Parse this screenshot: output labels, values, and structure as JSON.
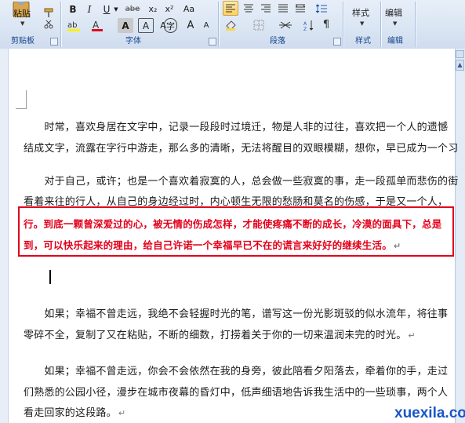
{
  "ribbon": {
    "groups": {
      "clipboard": "剪贴板",
      "font": "字体",
      "paragraph": "段落",
      "styles": "样式",
      "editing": "编辑"
    },
    "paste_label": "粘贴",
    "styles_label": "样式",
    "editing_label": "编辑",
    "font_buttons": [
      "B",
      "I",
      "U",
      "abe",
      "x₂",
      "x²",
      "Aa"
    ],
    "font_row2": [
      "A",
      "A",
      "A",
      "字",
      "A",
      "A"
    ]
  },
  "document": {
    "lines": [
      {
        "text": "　　时常，喜欢身居在文字中，记录一段段时过境迁，物是人非的过往，喜欢把一个人的遗憾",
        "style": "normal"
      },
      {
        "text": "结成文字，流露在字行中游走，那么多的清晰，无法将醒目的双眼模糊，想你，早已成为一个习",
        "style": "normal"
      },
      {
        "text": "　　对于自己，或许；也是一个喜欢着寂寞的人，总会做一些寂寞的事，走一段孤单而悲伤的街",
        "style": "normal"
      },
      {
        "text": "看着来往的行人，从自己的身边经过时，内心顿生无限的愁肠和莫名的伤感，于是又一个人，",
        "style": "normal"
      },
      {
        "text": "行。到底一颗曾深爱过的心，被无情的伤成怎样，才能使疼痛不断的成长，冷漠的面具下，总是",
        "style": "red"
      },
      {
        "text": "到，可以快乐起来的理由，给自己许诺一个幸福早已不在的谎言来好好的继续生活。",
        "style": "red"
      },
      {
        "text": "　　如果；幸福不曾走远，我绝不会轻握时光的笔，谱写这一份光影斑驳的似水流年，将往事",
        "style": "normal"
      },
      {
        "text": "零碎不全，复制了又在粘贴，不断的细数，打捞着关于你的一切来温润未完的时光。",
        "style": "normal"
      },
      {
        "text": "　　如果；幸福不曾走远，你会不会依然在我的身旁，彼此陪看夕阳落去，牵着你的手，走过",
        "style": "normal"
      },
      {
        "text": "们熟悉的公园小径，漫步在城市夜幕的昏灯中，低声细语地告诉我生活中的一些琐事，两个人",
        "style": "normal"
      },
      {
        "text": "看走回家的这段路。",
        "style": "normal"
      }
    ],
    "paragraph_mark": "↵"
  },
  "watermark": "xuexila.com"
}
